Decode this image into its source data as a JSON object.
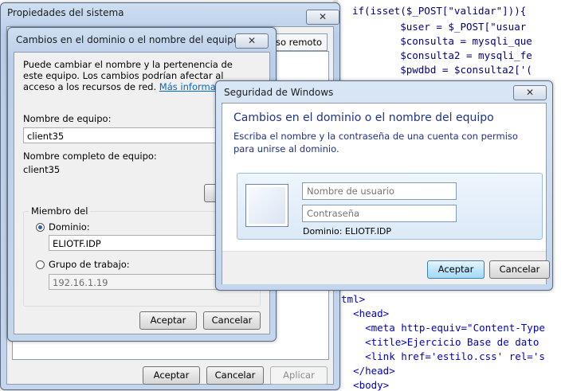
{
  "code_editor": {
    "lines": [
      {
        "text": "if(isset($_POST[\"validar\"])){"
      },
      {
        "text": "        $user = $_POST[\"usuar"
      },
      {
        "text": "        $consulta = mysqli_que"
      },
      {
        "text": "        $consulta2 = mysqli_fe"
      },
      {
        "text": "        $pwdbd = $consulta2['("
      },
      {
        "text": "tml>"
      },
      {
        "text": "  <head>"
      },
      {
        "text": "    <meta http-equiv=\"Content-Type"
      },
      {
        "text": "    <title>Ejercicio Base de dato"
      },
      {
        "text": "    <link href='estilo.css' rel='s"
      },
      {
        "text": "  </head>"
      },
      {
        "text": "  <body>"
      }
    ]
  },
  "system_props": {
    "title": "Propiedades del sistema",
    "close": "✕",
    "tab_partial": "so remoto",
    "ok": "Aceptar",
    "cancel": "Cancelar",
    "apply": "Aplicar"
  },
  "domain_dialog": {
    "title": "Cambios en el dominio o el nombre del equipo",
    "close": "✕",
    "description": "Puede cambiar el nombre y la pertenencia de este equipo. Los cambios podrían afectar al acceso a los recursos de red.",
    "more_info": "Más información",
    "computer_name_label": "Nombre de equipo:",
    "computer_name_value": "client35",
    "full_name_label": "Nombre completo de equipo:",
    "full_name_value": "client35",
    "member_of_label": "Miembro del",
    "domain_label": "Dominio:",
    "domain_value": "ELIOTF.IDP",
    "workgroup_label": "Grupo de trabajo:",
    "workgroup_value": "192.16.1.19",
    "ok": "Aceptar",
    "cancel": "Cancelar"
  },
  "security_dialog": {
    "title": "Seguridad de Windows",
    "close": "✕",
    "heading": "Cambios en el dominio o el nombre del equipo",
    "instruction": "Escriba el nombre y la contraseña de una cuenta con permiso para unirse al dominio.",
    "username_placeholder": "Nombre de usuario",
    "password_placeholder": "Contraseña",
    "domain_text": "Dominio: ELIOTF.IDP",
    "ok": "Aceptar",
    "cancel": "Cancelar"
  }
}
